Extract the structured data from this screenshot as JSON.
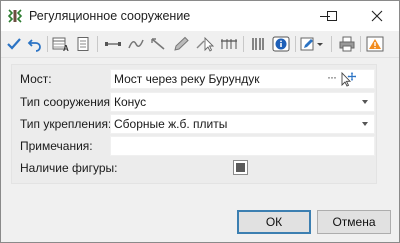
{
  "window": {
    "title": "Регуляционное сооружение",
    "controls": {
      "minimize": "—",
      "maximize": "☐",
      "close": "✕"
    }
  },
  "toolbar": {
    "icons": [
      "check-icon",
      "undo-icon",
      "table-edit-icon",
      "document-icon",
      "line-tool-icon",
      "curve-tool-icon",
      "ruler-icon",
      "pencil-icon",
      "pointer-icon",
      "dimension-icon",
      "split-icon",
      "info-icon",
      "edit-dropdown-icon",
      "print-icon",
      "warning-icon"
    ]
  },
  "form": {
    "bridge_label": "Мост:",
    "bridge_value": "Мост через реку Бурундук",
    "bridge_ellipsis": "···",
    "structure_type_label": "Тип сооружения:",
    "structure_type_value": "Конус",
    "reinforcement_type_label": "Тип укрепления:",
    "reinforcement_type_value": "Сборные ж.б. плиты",
    "notes_label": "Примечания:",
    "notes_value": "",
    "figure_label": "Наличие фигуры:",
    "figure_checked": true
  },
  "buttons": {
    "ok": "ОК",
    "cancel": "Отмена"
  },
  "colors": {
    "accent_blue": "#2b73c4",
    "warning_orange": "#f28c1e",
    "info_blue": "#1d5fb8"
  }
}
